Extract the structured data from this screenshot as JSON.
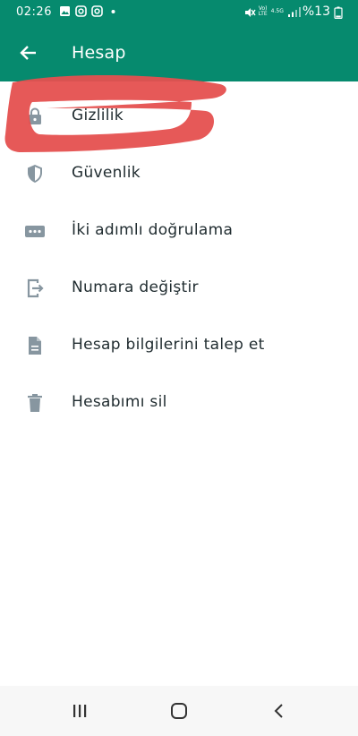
{
  "status_bar": {
    "time": "02:26",
    "network_top": "Vo)",
    "network_bottom": "LTE",
    "signal_label": "4.5G",
    "battery": "%13"
  },
  "toolbar": {
    "title": "Hesap"
  },
  "menu": {
    "items": [
      {
        "label": "Gizlilik",
        "icon": "lock-icon"
      },
      {
        "label": "Güvenlik",
        "icon": "shield-icon"
      },
      {
        "label": "İki adımlı doğrulama",
        "icon": "dots-icon"
      },
      {
        "label": "Numara değiştir",
        "icon": "phone-change-icon"
      },
      {
        "label": "Hesap bilgilerini talep et",
        "icon": "document-icon"
      },
      {
        "label": "Hesabımı sil",
        "icon": "trash-icon"
      }
    ]
  },
  "colors": {
    "header": "#068a6e",
    "icon": "#8796a0",
    "annotation": "#e5504f"
  }
}
